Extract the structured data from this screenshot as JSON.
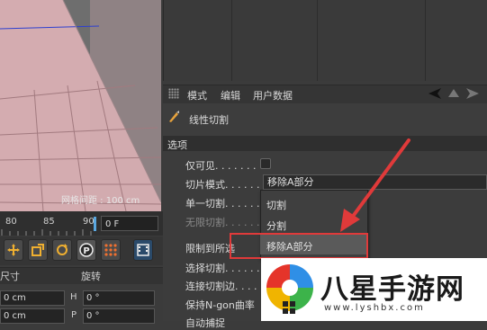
{
  "viewport": {
    "grid_spacing_label": "网格间距 : 100 cm"
  },
  "timeline": {
    "ticks": [
      "80",
      "85",
      "90"
    ],
    "frame_value": "0 F"
  },
  "coords": {
    "size_header": "尺寸",
    "rotation_header": "旋转",
    "fields": {
      "pos_x": "0 cm",
      "axis_h": "H",
      "rot_h": "0 °",
      "pos_y": "0 cm",
      "axis_p": "P",
      "rot_p": "0 °"
    }
  },
  "attr_menu": {
    "mode": "模式",
    "edit": "编辑",
    "user_data": "用户数据"
  },
  "tool": {
    "title": "线性切割"
  },
  "section": {
    "options": "选项"
  },
  "props": {
    "visible_only": "仅可见. . . . . . .",
    "slice_mode": "切片模式. . . . . .",
    "slice_mode_value": "移除A部分",
    "single_cut": "单一切割. . . . . .",
    "infinite_cut": "无限切割. . . . . .",
    "limit_selection": "限制到所选",
    "select_cuts": "选择切割. . . . . .",
    "connect_cut_edges": "连接切割边. . . . .",
    "keep_ngon_curvature": "保持N-gon曲率",
    "auto_snap": "自动捕捉"
  },
  "popup": {
    "options": [
      "切割",
      "分割",
      "移除A部分"
    ]
  },
  "watermark": {
    "title": "八星手游网",
    "url": "www.lyshbx.com"
  },
  "colors": {
    "viewport_surface": "#d6aeb1",
    "viewport_bg": "#6e6e6e",
    "annotation_red": "#e03a3a",
    "panel_bg": "#3c3c3c"
  }
}
